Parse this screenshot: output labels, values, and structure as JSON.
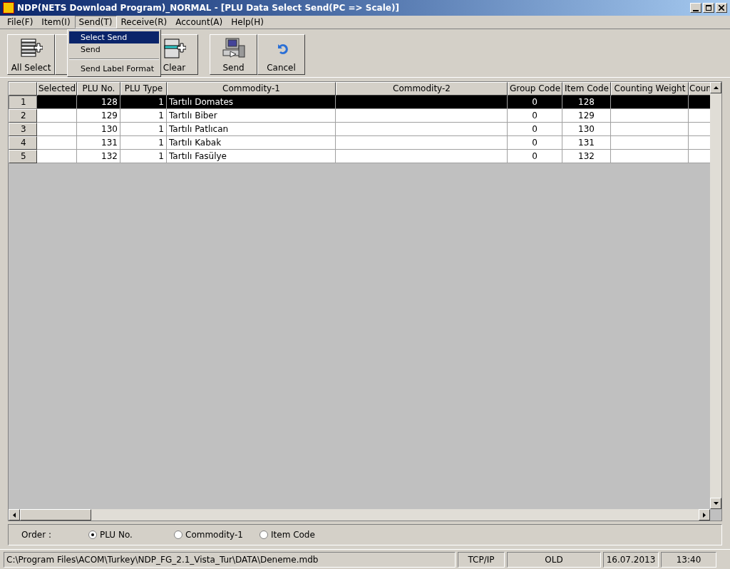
{
  "window": {
    "title": "NDP(NETS Download Program)_NORMAL - [PLU Data Select Send(PC => Scale)]"
  },
  "menu_bar": [
    {
      "label": "File(F)",
      "selected": false
    },
    {
      "label": "Item(I)",
      "selected": false
    },
    {
      "label": "Send(T)",
      "selected": true
    },
    {
      "label": "Receive(R)",
      "selected": false
    },
    {
      "label": "Account(A)",
      "selected": false
    },
    {
      "label": "Help(H)",
      "selected": false
    }
  ],
  "dropdown": [
    {
      "label": "Select Send",
      "selected": true
    },
    {
      "label": "Send",
      "selected": false
    },
    {
      "kind": "separator"
    },
    {
      "label": "Send Label Format",
      "selected": false
    }
  ],
  "toolbar": [
    {
      "label": "All Select",
      "kind": "list-add"
    },
    {
      "kind": "hidden"
    },
    {
      "label": "Clear",
      "kind": "clear"
    },
    {
      "label": "Send",
      "kind": "computer"
    },
    {
      "label": "Cancel",
      "kind": "undo"
    }
  ],
  "table": {
    "columns": [
      "Selected",
      "PLU No.",
      "PLU Type",
      "Commodity-1",
      "Commodity-2",
      "Group Code",
      "Item Code",
      "Counting Weight",
      "Coun"
    ],
    "rows": [
      {
        "number": "1",
        "selected": true,
        "cells": [
          "",
          "128",
          "1",
          "Tartılı Domates",
          "",
          "0",
          "128",
          "",
          ""
        ]
      },
      {
        "number": "2",
        "selected": false,
        "cells": [
          "",
          "129",
          "1",
          "Tartılı Biber",
          "",
          "0",
          "129",
          "",
          ""
        ]
      },
      {
        "number": "3",
        "selected": false,
        "cells": [
          "",
          "130",
          "1",
          "Tartılı Patlıcan",
          "",
          "0",
          "130",
          "",
          ""
        ]
      },
      {
        "number": "4",
        "selected": false,
        "cells": [
          "",
          "131",
          "1",
          "Tartılı Kabak",
          "",
          "0",
          "131",
          "",
          ""
        ]
      },
      {
        "number": "5",
        "selected": false,
        "cells": [
          "",
          "132",
          "1",
          "Tartılı Fasülye",
          "",
          "0",
          "132",
          "",
          ""
        ]
      }
    ]
  },
  "order": {
    "label": "Order :",
    "options": [
      {
        "label": "PLU No.",
        "selected": true
      },
      {
        "label": "Commodity-1",
        "selected": false
      },
      {
        "label": "Item Code",
        "selected": false
      }
    ]
  },
  "status_bar": [
    "C:\\Program Files\\ACOM\\Turkey\\NDP_FG_2.1_Vista_Tur\\DATA\\Deneme.mdb",
    "TCP/IP",
    "OLD",
    "16.07.2013",
    "13:40"
  ]
}
